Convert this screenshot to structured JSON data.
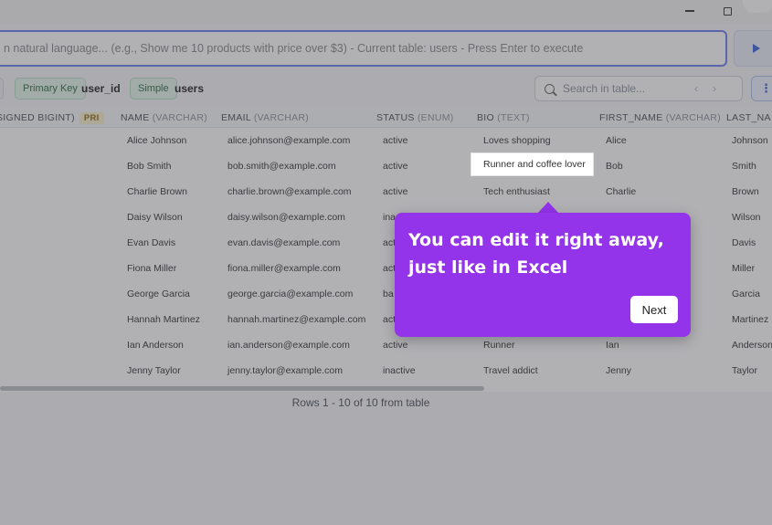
{
  "query": {
    "placeholder": "n natural language... (e.g., Show me 10 products with price over $3) - Current table: users - Press Enter to execute"
  },
  "info": {
    "primary_key_label": "Primary Key",
    "primary_key_value": "user_id",
    "mode_label": "Simple",
    "table_name": "users"
  },
  "search": {
    "placeholder": "Search in table...",
    "prev": "‹",
    "next": "›"
  },
  "table": {
    "columns": [
      {
        "name": "SIGNED BIGINT)",
        "type": "",
        "badge": "PRI"
      },
      {
        "name": "NAME ",
        "type": "(VARCHAR)"
      },
      {
        "name": "EMAIL ",
        "type": "(VARCHAR)"
      },
      {
        "name": "STATUS ",
        "type": "(ENUM)"
      },
      {
        "name": "BIO ",
        "type": "(TEXT)"
      },
      {
        "name": "FIRST_NAME ",
        "type": "(VARCHAR)"
      },
      {
        "name": "LAST_NA",
        "type": ""
      }
    ],
    "rows": [
      {
        "name": "Alice Johnson",
        "email": "alice.johnson@example.com",
        "status": "active",
        "bio": "Loves shopping",
        "first": "Alice",
        "last": "Johnson"
      },
      {
        "name": "Bob Smith",
        "email": "bob.smith@example.com",
        "status": "active",
        "bio": "Runner and coffee lover",
        "first": "Bob",
        "last": "Smith"
      },
      {
        "name": "Charlie Brown",
        "email": "charlie.brown@example.com",
        "status": "active",
        "bio": "Tech enthusiast",
        "first": "Charlie",
        "last": "Brown"
      },
      {
        "name": "Daisy Wilson",
        "email": "daisy.wilson@example.com",
        "status": "ina",
        "bio": "",
        "first": "",
        "last": "Wilson"
      },
      {
        "name": "Evan Davis",
        "email": "evan.davis@example.com",
        "status": "act",
        "bio": "",
        "first": "",
        "last": "Davis"
      },
      {
        "name": "Fiona Miller",
        "email": "fiona.miller@example.com",
        "status": "act",
        "bio": "",
        "first": "",
        "last": "Miller"
      },
      {
        "name": "George Garcia",
        "email": "george.garcia@example.com",
        "status": "ba",
        "bio": "",
        "first": "",
        "last": "Garcia"
      },
      {
        "name": "Hannah Martinez",
        "email": "hannah.martinez@example.com",
        "status": "act",
        "bio": "",
        "first": "",
        "last": "Martinez"
      },
      {
        "name": "Ian Anderson",
        "email": "ian.anderson@example.com",
        "status": "active",
        "bio": "Runner",
        "first": "Ian",
        "last": "Anderson"
      },
      {
        "name": "Jenny Taylor",
        "email": "jenny.taylor@example.com",
        "status": "inactive",
        "bio": "Travel addict",
        "first": "Jenny",
        "last": "Taylor"
      }
    ]
  },
  "footer": {
    "rows_text": "Rows 1 - 10 of 10 from table"
  },
  "tour": {
    "message": "You can edit it right away, just like in Excel",
    "next_label": "Next"
  },
  "colors": {
    "accent": "#9333ea",
    "primary": "#3a63d8"
  }
}
